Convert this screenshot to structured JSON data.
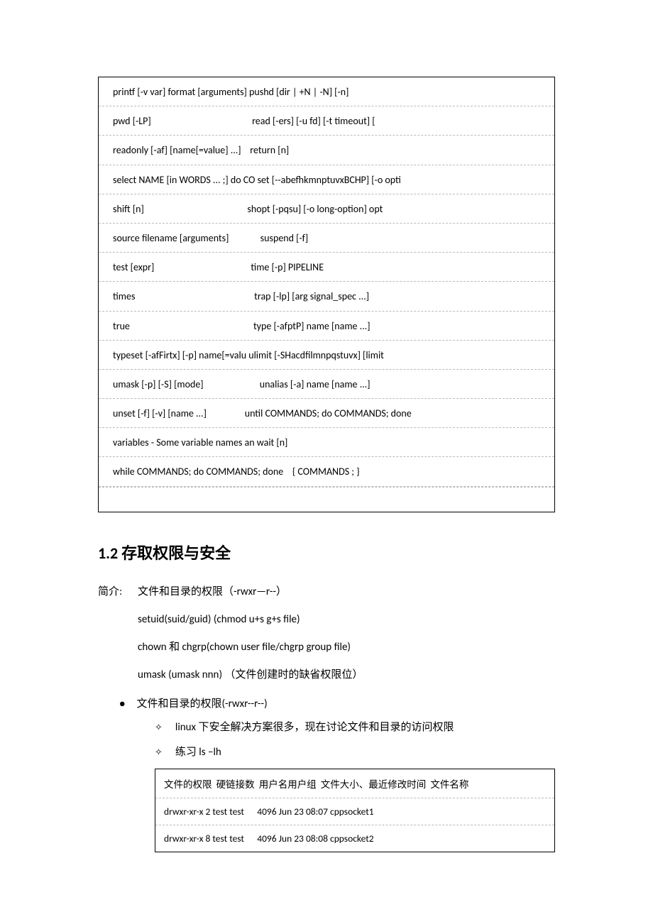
{
  "code_box": [
    "printf [-v var] format [arguments] pushd [dir | +N | -N] [-n]",
    "pwd [-LP]                                             read [-ers] [-u fd] [-t timeout] [",
    "readonly [-af] [name[=value] ...]    return [n]",
    "select NAME [in WORDS ... ;] do CO set [--abefhkmnptuvxBCHP] [-o opti",
    "shift [n]                                              shopt [-pqsu] [-o long-option] opt",
    "source filename [arguments]              suspend [-f]",
    "test [expr]                                           time [-p] PIPELINE",
    "times                                                     trap [-lp] [arg signal_spec ...]",
    "true                                                       type [-afptP] name [name ...]",
    "typeset [-afFirtx] [-p] name[=valu ulimit [-SHacdfilmnpqstuvx] [limit",
    "umask [-p] [-S] [mode]                         unalias [-a] name [name ...]",
    "unset [-f] [-v] [name ...]                 until COMMANDS; do COMMANDS; done",
    "variables - Some variable names an wait [n]",
    "while COMMANDS; do COMMANDS; done    { COMMANDS ; }"
  ],
  "section_title": "1.2 存取权限与安全",
  "intro_label": "简介:",
  "intro_line1": "文件和目录的权限（-rwxr—r--）",
  "intro_subs": [
    "setuid(suid/guid) (chmod u+s g+s file)",
    "chown 和 chgrp(chown user file/chgrp group file)",
    "umask (umask nnn)   （文件创建时的缺省权限位）"
  ],
  "bullet_text": "文件和目录的权限(-rwxr--r--)",
  "diamonds": [
    "linux 下安全解决方案很多，现在讨论文件和目录的访问权限",
    "练习 ls –lh"
  ],
  "table_lines": [
    "文件的权限  硬链接数  用户名用户组  文件大小、最近修改时间  文件名称",
    "drwxr-xr-x 2 test test      4096 Jun 23 08:07 cppsocket1",
    "drwxr-xr-x 8 test test      4096 Jun 23 08:08 cppsocket2"
  ]
}
